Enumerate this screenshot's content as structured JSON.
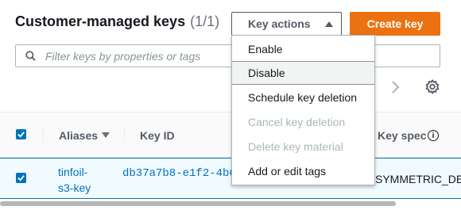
{
  "header": {
    "title": "Customer-managed keys",
    "count": "(1/1)",
    "key_actions_label": "Key actions",
    "create_key_label": "Create key"
  },
  "search": {
    "placeholder": "Filter keys by properties or tags"
  },
  "table": {
    "columns": {
      "aliases": "Aliases",
      "key_id": "Key ID",
      "key_spec": "Key spec"
    },
    "rows": [
      {
        "alias": "tinfoil-s3-key",
        "key_id": "db37a7b8-e1f2-4b6",
        "key_spec": "SYMMETRIC_DE",
        "selected": true
      }
    ]
  },
  "dropdown": {
    "items": [
      {
        "label": "Enable",
        "state": "enabled"
      },
      {
        "label": "Disable",
        "state": "hover"
      },
      {
        "label": "Schedule key deletion",
        "state": "enabled"
      },
      {
        "label": "Cancel key deletion",
        "state": "disabled"
      },
      {
        "label": "Delete key material",
        "state": "disabled"
      },
      {
        "label": "Add or edit tags",
        "state": "enabled"
      }
    ]
  },
  "colors": {
    "primary_orange": "#ec7211",
    "link_blue": "#0073bb",
    "selected_row_bg": "#f1faff"
  },
  "icons": [
    "search-icon",
    "caret-up-icon",
    "chevron-right-icon",
    "gear-icon",
    "sort-down-icon",
    "info-icon",
    "checkbox-checked-icon"
  ]
}
